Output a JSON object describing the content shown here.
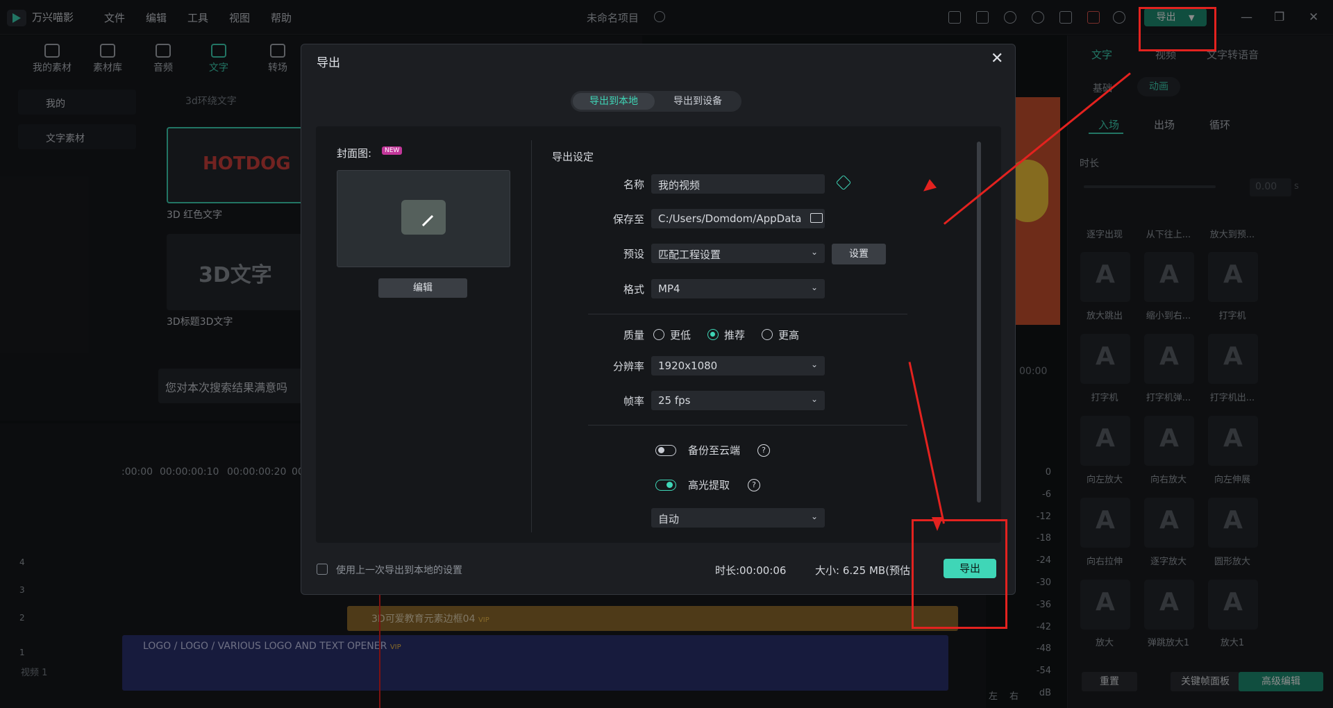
{
  "app": {
    "name": "万兴喵影",
    "project": "未命名项目",
    "menu": [
      "文件",
      "编辑",
      "工具",
      "视图",
      "帮助"
    ],
    "top_export": "导出"
  },
  "left": {
    "tabs": [
      "我的素材",
      "素材库",
      "音频",
      "文字",
      "转场"
    ],
    "sidebar": [
      "我的",
      "文字素材"
    ],
    "search_placeholder": "3d环绕文字",
    "thumbs": [
      {
        "art": "HOTDOG",
        "label": "3D 红色文字"
      },
      {
        "art": "3D文字",
        "label": "3D标题3D文字"
      }
    ],
    "feedback": "您对本次搜索结果满意吗"
  },
  "timeline": {
    "times": [
      ":00:00",
      "00:00:00:10",
      "00:00:00:20",
      "00"
    ],
    "clips": [
      {
        "text": "3D可爱教育元素边框04",
        "badge": "VIP"
      },
      {
        "text": "LOGO / LOGO / VARIOUS LOGO AND TEXT OPENER",
        "badge": "VIP"
      }
    ],
    "track_label": "视频 1",
    "tracks": [
      "4",
      "3",
      "2",
      "1"
    ],
    "db": [
      "0",
      "-6",
      "-12",
      "-18",
      "-24",
      "-30",
      "-36",
      "-42",
      "-48",
      "-54",
      "dB"
    ],
    "lr": [
      "左",
      "右"
    ],
    "preview_time": "00:00"
  },
  "right": {
    "tabs": [
      "文字",
      "视频",
      "文字转语音"
    ],
    "subtabs": [
      "基础",
      "动画"
    ],
    "anim_tabs": [
      "入场",
      "出场",
      "循环"
    ],
    "duration_label": "时长",
    "duration_value": "0.00",
    "duration_unit": "s",
    "effects": [
      "逐字出现",
      "从下往上...",
      "放大到预...",
      "放大跳出",
      "缩小到右...",
      "打字机",
      "打字机",
      "打字机弹...",
      "打字机出...",
      "向左放大",
      "向右放大",
      "向左伸展",
      "向右拉伸",
      "逐字放大",
      "圆形放大",
      "放大",
      "弹跳放大1",
      "放大1"
    ],
    "buttons": [
      "重置",
      "关键帧面板",
      "高级编辑"
    ]
  },
  "dialog": {
    "title": "导出",
    "seg": [
      "导出到本地",
      "导出到设备"
    ],
    "cover_label": "封面图:",
    "new_badge": "NEW",
    "edit": "编辑",
    "settings_title": "导出设定",
    "name_label": "名称",
    "name_value": "我的视频",
    "save_label": "保存至",
    "save_value": "C:/Users/Domdom/AppData",
    "preset_label": "预设",
    "preset_value": "匹配工程设置",
    "preset_btn": "设置",
    "format_label": "格式",
    "format_value": "MP4",
    "quality_label": "质量",
    "quality_options": [
      "更低",
      "推荐",
      "更高"
    ],
    "res_label": "分辨率",
    "res_value": "1920x1080",
    "fps_label": "帧率",
    "fps_value": "25 fps",
    "cloud_label": "备份至云端",
    "highlight_label": "高光提取",
    "highlight_value": "自动",
    "last_settings": "使用上一次导出到本地的设置",
    "duration": "时长:00:00:06",
    "size": "大小: 6.25 MB(预估",
    "export": "导出"
  },
  "colors": {
    "accent": "#3fd6b7",
    "annotation": "#e3221f"
  }
}
